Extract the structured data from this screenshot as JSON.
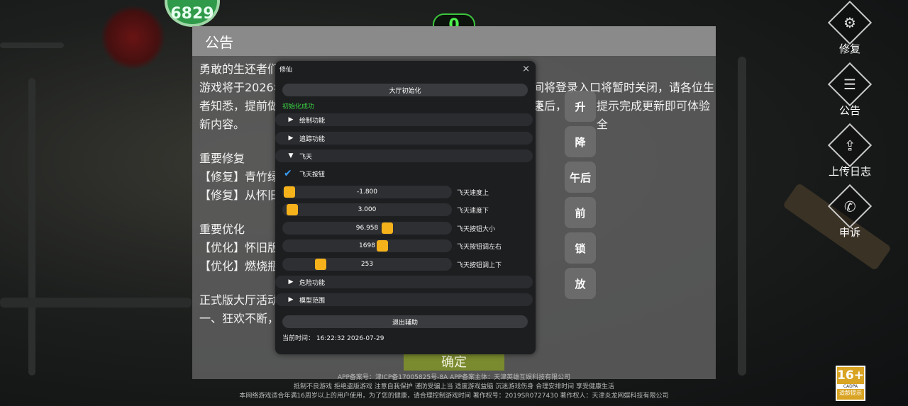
{
  "avatar_text": "6829",
  "counter": "0",
  "notice": {
    "title": "公告",
    "paragraphs": [
      "勇敢的生还者们",
      "游戏将于2026年",
      "者知悉，提前做",
      "新内容。"
    ],
    "right_fragments": [
      "间将登录入口将暂时关闭，请各位生还",
      "束后，",
      "提示完成更新即可体验全"
    ],
    "fix_heading": "重要修复",
    "fix_items": [
      "【修复】青竹绿",
      "【修复】从怀旧"
    ],
    "opt_heading": "重要优化",
    "opt_items": [
      "【优化】怀旧版",
      "【优化】燃烧瓶"
    ],
    "event_heading": "正式版大厅活动",
    "event_item": "一、狂欢不断，",
    "confirm": "确定"
  },
  "side_buttons": [
    {
      "label": "修复",
      "icon": "gears-icon",
      "glyph": "⚙"
    },
    {
      "label": "公告",
      "icon": "notice-icon",
      "glyph": "☰"
    },
    {
      "label": "上传日志",
      "icon": "upload-icon",
      "glyph": "⇪"
    },
    {
      "label": "申诉",
      "icon": "phone-icon",
      "glyph": "✆"
    }
  ],
  "action_buttons": [
    "升",
    "降",
    "午后",
    "前",
    "锁",
    "放"
  ],
  "menu": {
    "title": "修仙",
    "close": "×",
    "init_button": "大厅初始化",
    "init_status": "初始化成功",
    "sections": {
      "draw": "绘制功能",
      "track": "追踪功能",
      "fly": "飞天",
      "danger": "危险功能",
      "model": "模型范围"
    },
    "fly_button_label": "飞天按钮",
    "sliders": [
      {
        "value": "-1.800",
        "label": "飞天速度上",
        "ratio": 0.0
      },
      {
        "value": "3.000",
        "label": "飞天速度下",
        "ratio": 0.02
      },
      {
        "value": "96.958",
        "label": "飞天按钮大小",
        "ratio": 0.63
      },
      {
        "value": "1698",
        "label": "飞天按钮调左右",
        "ratio": 0.6
      },
      {
        "value": "253",
        "label": "飞天按钮调上下",
        "ratio": 0.2
      }
    ],
    "exit_button": "退出辅助",
    "time_label": "当前时间：",
    "time_value": "16:22:32 2026-07-29"
  },
  "footer": {
    "line1": "APP备案号：津ICP备17005825号-8A   APP备案主体：天津英雄互娱科技有限公司",
    "line2": "抵制不良游戏 拒绝盗版游戏 注意自我保护 谨防受骗上当 适度游戏益脑 沉迷游戏伤身 合理安排时间 享受健康生活",
    "line3": "本网络游戏适合年满16周岁以上的用户使用，为了您的健康，请合理控制游戏时间   著作权号：2019SR0727430   著作权人：天津炎龙网娱科技有限公司"
  },
  "age_badge": {
    "number": "16+",
    "org": "CADPA",
    "text": "适龄提示"
  }
}
